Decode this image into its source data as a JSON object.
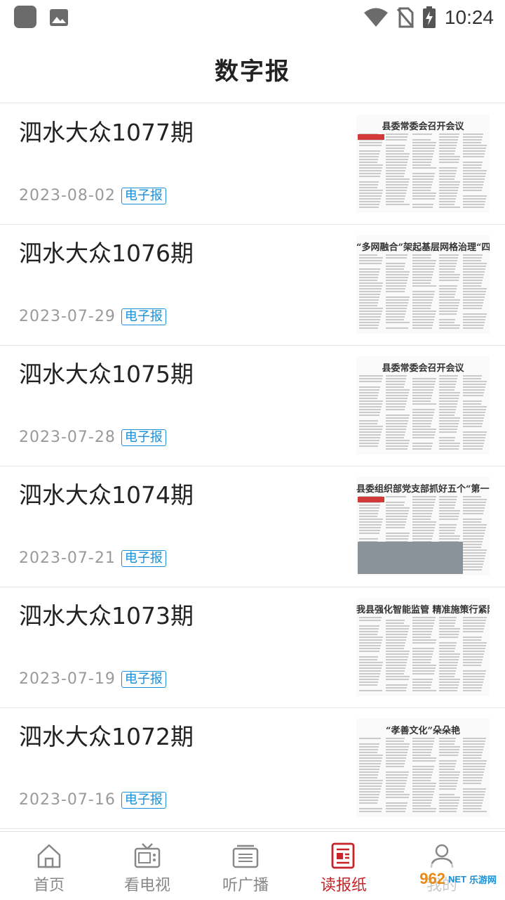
{
  "status_bar": {
    "time": "10:24",
    "icons": [
      "app-icon",
      "image-icon",
      "wifi-icon",
      "no-sim-icon",
      "battery-charging-icon"
    ]
  },
  "header": {
    "title": "数字报"
  },
  "issues": [
    {
      "title": "泗水大众1077期",
      "date": "2023-08-02",
      "tag": "电子报",
      "thumb_headline": "县委常委会召开会议"
    },
    {
      "title": "泗水大众1076期",
      "date": "2023-07-29",
      "tag": "电子报",
      "thumb_headline": "“多网融合”架起基层网格治理“四梁八柱”"
    },
    {
      "title": "泗水大众1075期",
      "date": "2023-07-28",
      "tag": "电子报",
      "thumb_headline": "县委常委会召开会议"
    },
    {
      "title": "泗水大众1074期",
      "date": "2023-07-21",
      "tag": "电子报",
      "thumb_headline": "县委组织部党支部抓好五个“第一”不断深化党建品牌培"
    },
    {
      "title": "泗水大众1073期",
      "date": "2023-07-19",
      "tag": "电子报",
      "thumb_headline": "我县强化智能监管 精准施策行紧防溺水“安全阀"
    },
    {
      "title": "泗水大众1072期",
      "date": "2023-07-16",
      "tag": "电子报",
      "thumb_headline": "“孝善文化”朵朵艳"
    }
  ],
  "tabbar": {
    "items": [
      {
        "label": "首页",
        "icon": "home-icon",
        "active": false
      },
      {
        "label": "看电视",
        "icon": "tv-icon",
        "active": false
      },
      {
        "label": "听广播",
        "icon": "radio-icon",
        "active": false
      },
      {
        "label": "读报纸",
        "icon": "newspaper-icon",
        "active": true
      },
      {
        "label": "我的",
        "icon": "user-icon",
        "active": false
      }
    ],
    "active_color": "#c62428",
    "inactive_color": "#888888"
  },
  "watermark": {
    "brand": "962",
    "suffix": "NET",
    "sub": "乐游网"
  }
}
